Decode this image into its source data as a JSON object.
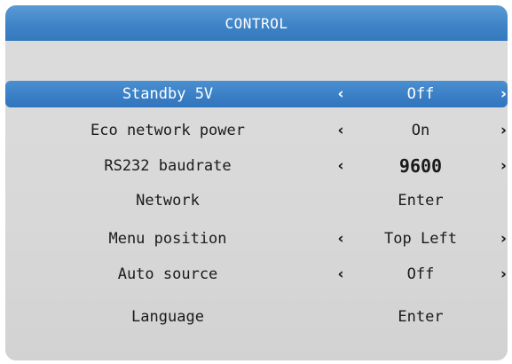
{
  "menu": {
    "title": "CONTROL",
    "left_arrow": "‹",
    "right_arrow": "›",
    "items": [
      {
        "label": "Standby 5V",
        "value": "Off",
        "has_arrows": true,
        "selected": true
      },
      {
        "label": "Eco network power",
        "value": "On",
        "has_arrows": true,
        "selected": false
      },
      {
        "label": "RS232 baudrate",
        "value": "9600",
        "has_arrows": true,
        "selected": false
      },
      {
        "label": "Network",
        "value": "Enter",
        "has_arrows": false,
        "selected": false
      },
      {
        "label": "Menu position",
        "value": "Top Left",
        "has_arrows": true,
        "selected": false
      },
      {
        "label": "Auto source",
        "value": "Off",
        "has_arrows": true,
        "selected": false
      },
      {
        "label": "Language",
        "value": "Enter",
        "has_arrows": false,
        "selected": false
      }
    ]
  },
  "colors": {
    "title_bar": "#3f84c7",
    "selected_row": "#3a7fc6",
    "panel_background": "#d9d9d9"
  }
}
